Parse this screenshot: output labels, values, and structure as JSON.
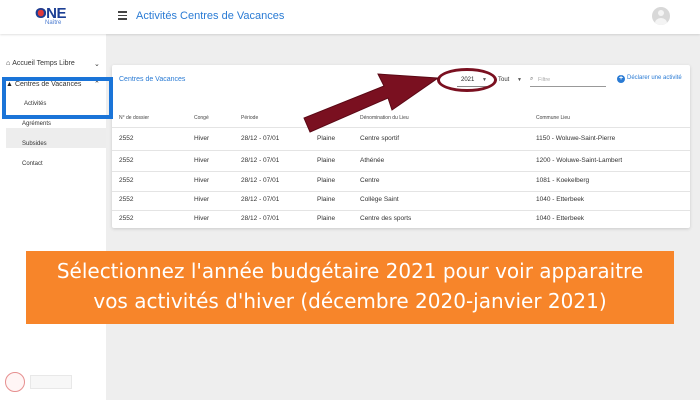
{
  "header": {
    "logo_text": "ONE",
    "logo_sub": "Naître",
    "title": "Activités Centres de Vacances"
  },
  "sidebar": {
    "accueil_label": "Accueil Temps Libre",
    "centres_label": "Centres de Vacances",
    "sub_items": [
      "Activités",
      "Agréments",
      "Subsides",
      "Contact"
    ]
  },
  "card": {
    "title": "Centres de Vacances",
    "year_value": "2021",
    "tout_value": "Tout",
    "filter_placeholder": "Filtre",
    "declare_label": "Déclarer une activité",
    "columns": [
      "N° de dossier",
      "Congé",
      "Période",
      "Type",
      "Dénomination du Lieu",
      "Commune Lieu"
    ],
    "rows": [
      [
        "2552",
        "Hiver",
        "28/12 - 07/01",
        "Plaine",
        "Centre sportif",
        "1150 - Woluwe-Saint-Pierre"
      ],
      [
        "2552",
        "Hiver",
        "28/12 - 07/01",
        "Plaine",
        "Athénée",
        "1200 - Woluwe-Saint-Lambert"
      ],
      [
        "2552",
        "Hiver",
        "28/12 - 07/01",
        "Plaine",
        "Centre",
        "1081 - Koekelberg"
      ],
      [
        "2552",
        "Hiver",
        "28/12 - 07/01",
        "Plaine",
        "Collège Saint",
        "1040 - Etterbeek"
      ],
      [
        "2552",
        "Hiver",
        "28/12 - 07/01",
        "Plaine",
        "Centre des sports",
        "1040 - Etterbeek"
      ]
    ]
  },
  "banner": {
    "line1": "Sélectionnez l'année budgétaire 2021 pour voir apparaitre",
    "line2": "vos activités d'hiver (décembre 2020-janvier 2021)"
  },
  "colors": {
    "accent_blue": "#2a7bd4",
    "highlight_blue": "#1a74d8",
    "annotation_red": "#7a1020",
    "banner_orange": "#f7852a"
  }
}
